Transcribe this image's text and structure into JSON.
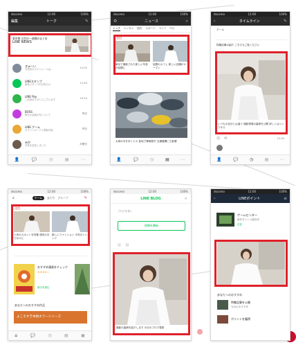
{
  "colors": {
    "highlight": "#e0202a",
    "line_green": "#06c755",
    "dark_header": "#2b2b2b"
  },
  "p1": {
    "status": [
      "docomo",
      "12:00",
      "100%"
    ],
    "header": {
      "left": "編集",
      "title": "トーク",
      "right_icon": "compose-icon"
    },
    "banner": {
      "title": "東京都 注目の一週間のまとめ",
      "subtitle": "LINE NEWS",
      "meta": ""
    },
    "rows": [
      {
        "name": "きゅーい",
        "msg": "今週末のスケジュールは…",
        "time": "12:01"
      },
      {
        "name": "LINEスタンプ",
        "msg": "新着スタンプのお知らせ",
        "time": "11:45"
      },
      {
        "name": "LINE Pay",
        "msg": "ご利用ありがとうございます",
        "time": "10:20"
      },
      {
        "name": "BOSS",
        "msg": "明日の会議の件について",
        "time": "昨日"
      },
      {
        "name": "LINE ゲーム",
        "msg": "ログインボーナス受取可能",
        "time": "昨日"
      },
      {
        "name": "みか",
        "msg": "写真を送信しました",
        "time": "月曜日"
      }
    ]
  },
  "p2": {
    "status": [
      "docomo",
      "12:00",
      "100%"
    ],
    "header": {
      "title": "ニュース"
    },
    "tabs": [
      "トップ",
      "エンタメ",
      "国内",
      "スポーツ",
      "ライフ",
      "ITセ"
    ],
    "section": "注目",
    "item1": "東京で撮影された新しい写真が話題に",
    "item2": "話題のカフェ 新しい店舗がオープン",
    "big_caption": "大雨の中を歩く人々 各地で警報発令 交通機関にも影響"
  },
  "p3": {
    "status": [
      "docomo",
      "12:00",
      "100%"
    ],
    "header": {
      "title": "タイムライン"
    },
    "top_text": "ホーム",
    "post_text": "特集記事の紹介 こちらもご覧ください",
    "caption": "いつもの自分とは違う 撮影現場の裏側を公開 詳しくはリンクから",
    "time": "12:00"
  },
  "p4": {
    "status": [
      "docomo",
      "12:00",
      "100%"
    ],
    "tabs": [
      "ホーム",
      "友だち",
      "グループ"
    ],
    "section": "注目",
    "item1": "人気のスポットを特集 週末のおでかけに",
    "item2": "新しいファッション 今年のトレンド",
    "manga_title": "おすすめ漫画をチェック",
    "manga_sub": "★★★★☆",
    "manga_more": "続きを読む",
    "section2": "あなたへのおすすめ作品",
    "banner": "よこそすぎ本格ホラーシリーズ"
  },
  "p5": {
    "status": [
      "docomo",
      "12:00",
      "100%"
    ],
    "logo": "LINE BLOG",
    "field_label": "ブログを書く",
    "button": "投稿を開始",
    "caption": "撮影の裏側を紹介します 今日のブログ更新"
  },
  "p6": {
    "status": [
      "docomo",
      "12:00",
      "100%"
    ],
    "header": {
      "title": "LINEポイント"
    },
    "ad_title": "ゲームセンター",
    "ad_sub": "新作タイトル配信中",
    "ad_tag": "広告",
    "section": "あなたへのおすすめ",
    "item1_title": "特集記事を公開",
    "item1_sub": "今月のおすすめ",
    "item2_title": "ポイントを獲得"
  }
}
